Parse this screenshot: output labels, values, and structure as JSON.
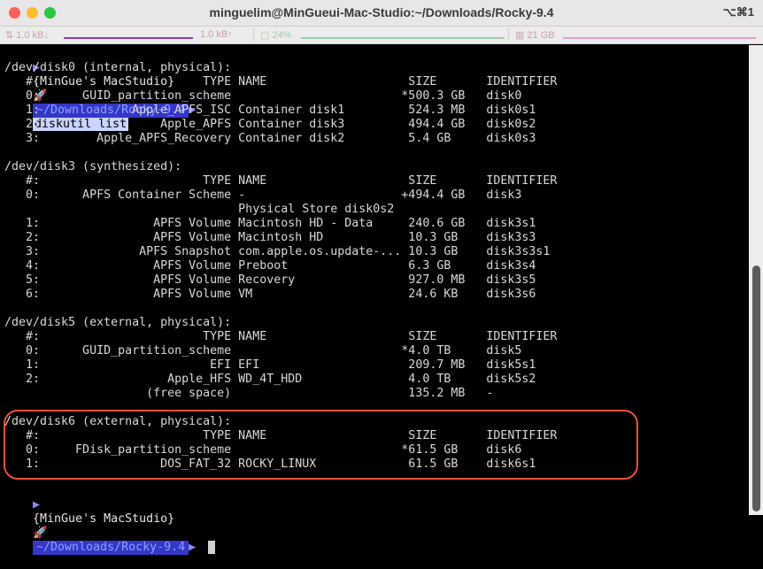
{
  "window": {
    "title": "minguelim@MinGueui-Mac-Studio:~/Downloads/Rocky-9.4",
    "shortcut": "⌥⌘1"
  },
  "status_bar": {
    "net_down": "1.0 kB↓",
    "net_up": "1.0 kB↑",
    "cpu": "24%",
    "memory": "21 GB"
  },
  "prompt": {
    "host": "{MinGue's MacStudio}",
    "emoji": "🚀",
    "path": "~/Downloads/Rocky-9.4",
    "command": "diskutil list"
  },
  "output_lines": [
    "/dev/disk0 (internal, physical):",
    "   #:                       TYPE NAME                    SIZE       IDENTIFIER",
    "   0:      GUID_partition_scheme                        *500.3 GB   disk0",
    "   1:             Apple_APFS_ISC Container disk1         524.3 MB   disk0s1",
    "   2:                 Apple_APFS Container disk3         494.4 GB   disk0s2",
    "   3:        Apple_APFS_Recovery Container disk2         5.4 GB     disk0s3",
    "",
    "/dev/disk3 (synthesized):",
    "   #:                       TYPE NAME                    SIZE       IDENTIFIER",
    "   0:      APFS Container Scheme -                      +494.4 GB   disk3",
    "                                 Physical Store disk0s2",
    "   1:                APFS Volume Macintosh HD - Data     240.6 GB   disk3s1",
    "   2:                APFS Volume Macintosh HD            10.3 GB    disk3s3",
    "   3:              APFS Snapshot com.apple.os.update-... 10.3 GB    disk3s3s1",
    "   4:                APFS Volume Preboot                 6.3 GB     disk3s4",
    "   5:                APFS Volume Recovery                927.0 MB   disk3s5",
    "   6:                APFS Volume VM                      24.6 KB    disk3s6",
    "",
    "/dev/disk5 (external, physical):",
    "   #:                       TYPE NAME                    SIZE       IDENTIFIER",
    "   0:      GUID_partition_scheme                        *4.0 TB     disk5",
    "   1:                        EFI EFI                     209.7 MB   disk5s1",
    "   2:                  Apple_HFS WD_4T_HDD               4.0 TB     disk5s2",
    "                    (free space)                         135.2 MB   -",
    "",
    "/dev/disk6 (external, physical):",
    "   #:                       TYPE NAME                    SIZE       IDENTIFIER",
    "   0:     FDisk_partition_scheme                        *61.5 GB    disk6",
    "   1:                 DOS_FAT_32 ROCKY_LINUX             61.5 GB    disk6s1"
  ],
  "colors": {
    "highlight": "#e8533b",
    "path_bg": "#3437c7"
  }
}
